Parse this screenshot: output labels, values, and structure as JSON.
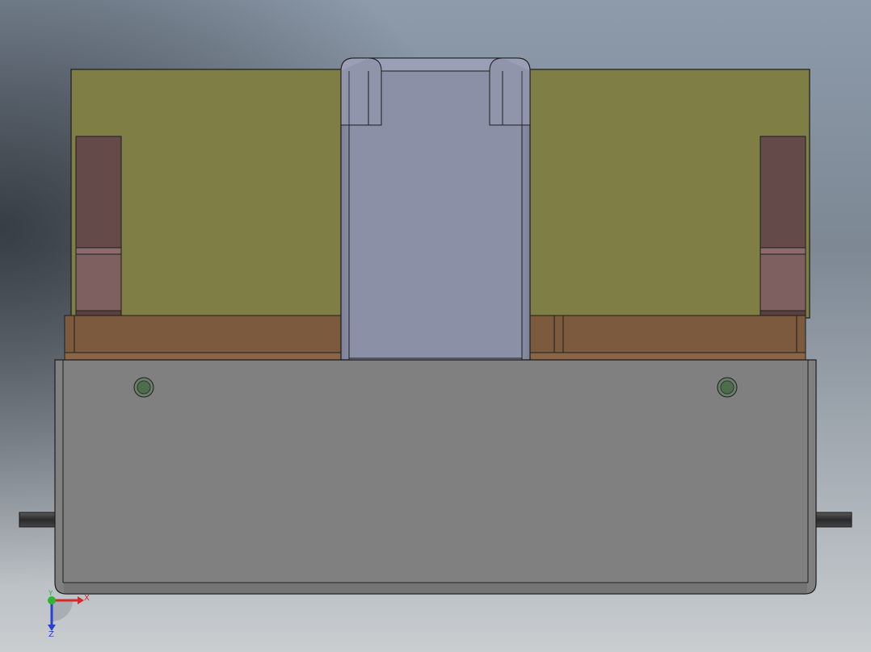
{
  "viewport": {
    "background_top": "#8d9bab",
    "background_mid": "#3a4148",
    "background_bottom": "#c9cdd0"
  },
  "colors": {
    "top_plate": "#7f7f45",
    "guide_block_dark": "#654a4a",
    "guide_block_light": "#7e6060",
    "wood_strip": "#7b5a3e",
    "wood_strip_edge": "#8a6646",
    "center_block": "#8b90a6",
    "center_block_edge": "#b4b8cc",
    "base_block": "#808080",
    "base_shadow": "#6e6e6e",
    "rod": "#333333",
    "screw_head": "#4d6d4d",
    "screw_ring": "#3e583e",
    "outline": "#1e1e1e"
  },
  "triad": {
    "x_label": "X",
    "y_label": "Y",
    "z_label": "Z",
    "x_color": "#d42a2a",
    "y_color": "#2fb52f",
    "z_color": "#2a3fd4"
  }
}
